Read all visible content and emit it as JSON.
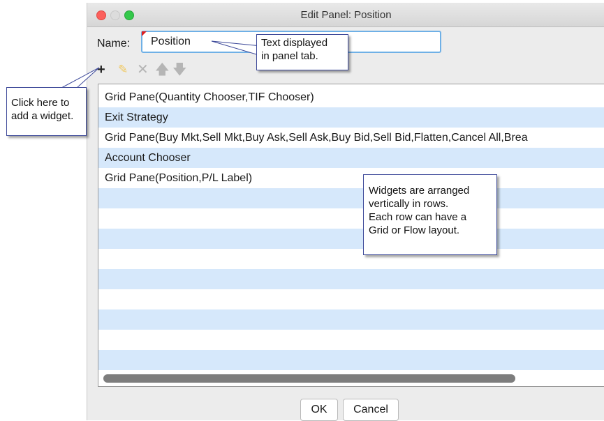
{
  "window": {
    "title": "Edit Panel: Position"
  },
  "name_field": {
    "label": "Name:",
    "value": "Position"
  },
  "toolbar": {
    "add": "+",
    "edit": "✎",
    "delete": "✕",
    "up": "🡅",
    "down": "🡇"
  },
  "rows": [
    "Grid Pane(Quantity Chooser,TIF Chooser)",
    "Exit Strategy",
    "Grid Pane(Buy Mkt,Sell Mkt,Buy Ask,Sell Ask,Buy Bid,Sell Bid,Flatten,Cancel All,Brea",
    "Account Chooser",
    "Grid Pane(Position,P/L Label)"
  ],
  "buttons": {
    "ok": "OK",
    "cancel": "Cancel"
  },
  "callouts": {
    "name_tip": [
      "Text displayed",
      "in panel tab."
    ],
    "add_tip": [
      "Click here to",
      "add a widget."
    ],
    "rows_tip": [
      "Widgets are arranged",
      "vertically in rows.",
      "Each row can have a",
      "Grid or Flow layout."
    ]
  },
  "colors": {
    "row_alt": "#d6e8fb",
    "callout_border": "#3e4a9a",
    "focus_ring": "#6fb0e6"
  }
}
